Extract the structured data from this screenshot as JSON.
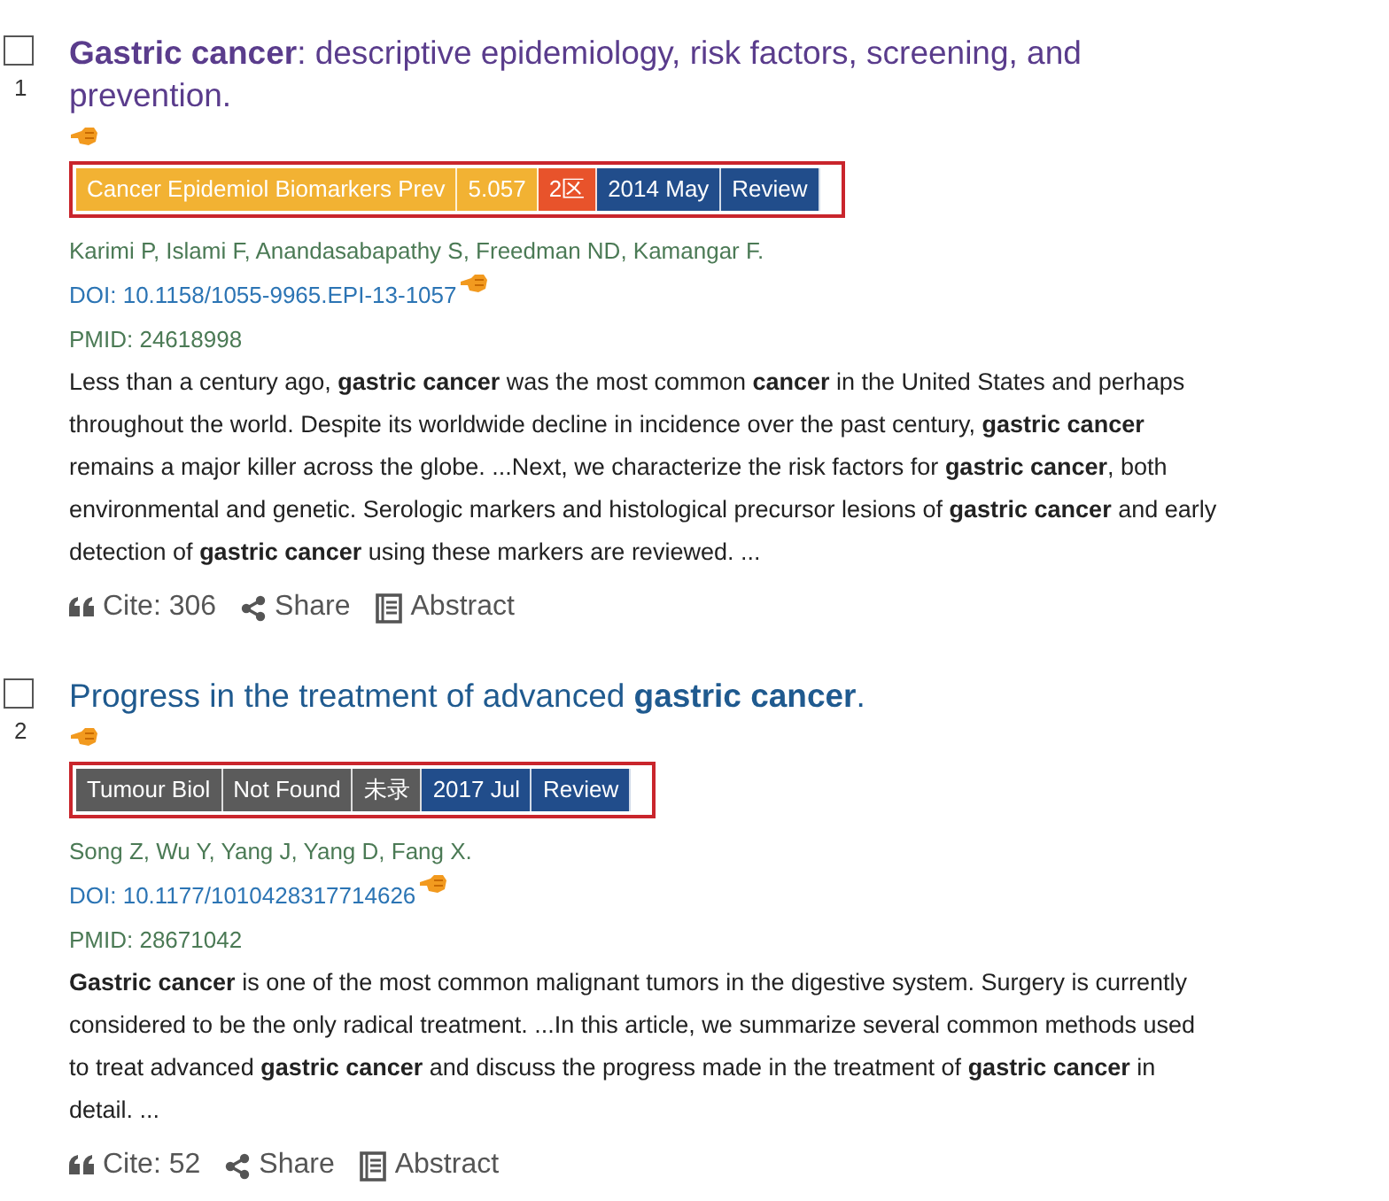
{
  "results": [
    {
      "number": "1",
      "checked": false,
      "visited": true,
      "title": "**Gastric cancer**: descriptive epidemiology, risk factors, screening, and prevention.",
      "badges": [
        {
          "text": "Cancer Epidemiol Biomarkers Prev",
          "color": "#f2b233"
        },
        {
          "text": "5.057",
          "color": "#f2b233"
        },
        {
          "text": "2区",
          "color": "#e8532b"
        },
        {
          "text": "2014 May",
          "color": "#214d8b"
        },
        {
          "text": "Review",
          "color": "#214d8b"
        }
      ],
      "authors": "Karimi P, Islami F, Anandasabapathy S, Freedman ND, Kamangar F.",
      "doi": "DOI: 10.1158/1055-9965.EPI-13-1057",
      "pmid": "PMID: 24618998",
      "abstract": "Less than a century ago, **gastric cancer** was the most common **cancer** in the United States and perhaps throughout the world. Despite its worldwide decline in incidence over the past century, **gastric cancer** remains a major killer across the globe. ...Next, we characterize the risk factors for **gastric cancer**, both environmental and genetic. Serologic markers and histological precursor lesions of **gastric cancer** and early detection of **gastric cancer** using these markers are reviewed. ...",
      "actions": [
        {
          "kind": "cite",
          "label": "Cite: 306"
        },
        {
          "kind": "share",
          "label": "Share"
        },
        {
          "kind": "abstract",
          "label": "Abstract"
        }
      ]
    },
    {
      "number": "2",
      "checked": false,
      "visited": false,
      "title": "Progress in the treatment of advanced **gastric cancer**.",
      "badges": [
        {
          "text": "Tumour Biol",
          "color": "#5b5b5b"
        },
        {
          "text": "Not Found",
          "color": "#5b5b5b"
        },
        {
          "text": "未录",
          "color": "#5b5b5b"
        },
        {
          "text": "2017 Jul",
          "color": "#214d8b"
        },
        {
          "text": "Review",
          "color": "#214d8b"
        }
      ],
      "authors": "Song Z, Wu Y, Yang J, Yang D, Fang X.",
      "doi": "DOI: 10.1177/1010428317714626",
      "pmid": "PMID: 28671042",
      "abstract": "**Gastric cancer** is one of the most common malignant tumors in the digestive system. Surgery is currently considered to be the only radical treatment. ...In this article, we summarize several common methods used to treat advanced **gastric cancer** and discuss the progress made in the treatment of **gastric cancer** in detail. ...",
      "actions": [
        {
          "kind": "cite",
          "label": "Cite: 52"
        },
        {
          "kind": "share",
          "label": "Share"
        },
        {
          "kind": "abstract",
          "label": "Abstract"
        }
      ]
    }
  ]
}
